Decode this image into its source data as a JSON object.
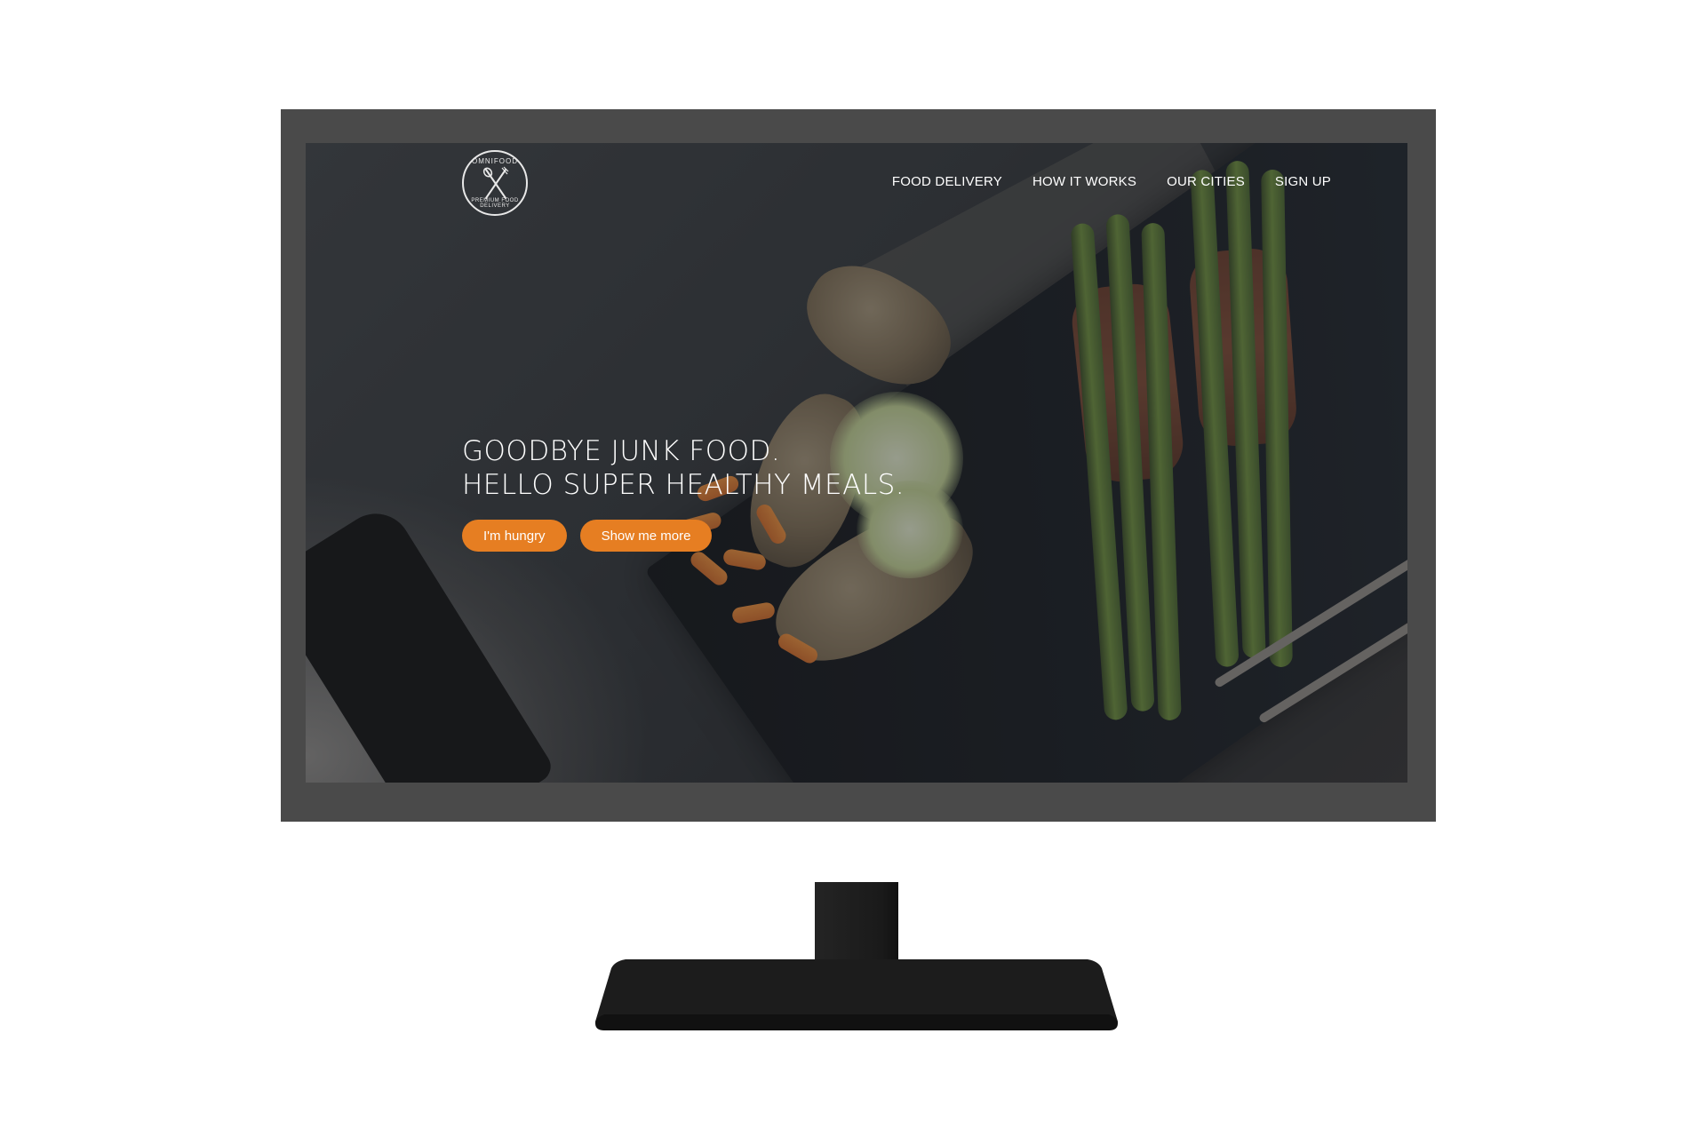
{
  "logo": {
    "top_text": "OMNIFOOD",
    "bottom_text": "PREMIUM FOOD DELIVERY",
    "icon": "fork-and-spoon-icon"
  },
  "nav": {
    "items": [
      {
        "label": "FOOD DELIVERY"
      },
      {
        "label": "HOW IT WORKS"
      },
      {
        "label": "OUR CITIES"
      },
      {
        "label": "SIGN UP"
      }
    ]
  },
  "hero": {
    "line1": "GOODBYE JUNK FOOD.",
    "line2": "HELLO SUPER HEALTHY MEALS.",
    "buttons": {
      "primary": "I'm hungry",
      "secondary": "Show me more"
    }
  },
  "colors": {
    "accent": "#e67e22",
    "nav_text": "#ffffff",
    "monitor_frame": "#4a4a4a",
    "stand": "#1c1c1c"
  }
}
